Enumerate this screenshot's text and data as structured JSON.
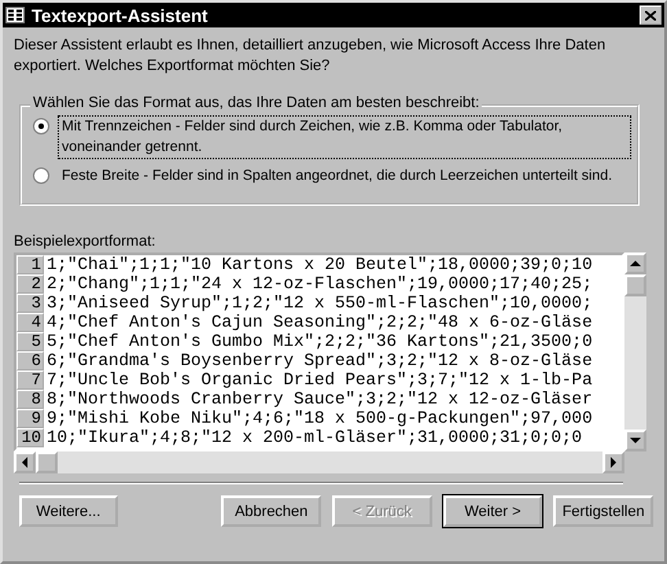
{
  "window": {
    "title": "Textexport-Assistent"
  },
  "intro": "Dieser Assistent erlaubt es Ihnen, detailliert anzugeben, wie Microsoft Access Ihre Daten exportiert.  Welches Exportformat möchten Sie?",
  "format_group": {
    "legend": "Wählen Sie das Format aus, das Ihre Daten am besten beschreibt:",
    "options": [
      {
        "label": "Mit Trennzeichen - Felder sind durch Zeichen, wie z.B. Komma oder Tabulator, voneinander getrennt.",
        "selected": true
      },
      {
        "label": "Feste Breite - Felder sind in Spalten angeordnet, die durch Leerzeichen unterteilt sind.",
        "selected": false
      }
    ]
  },
  "preview": {
    "label": "Beispielexportformat:",
    "rows": [
      {
        "number": "1",
        "text": "1;\"Chai\";1;1;\"10 Kartons x 20 Beutel\";18,0000;39;0;10"
      },
      {
        "number": "2",
        "text": "2;\"Chang\";1;1;\"24 x 12-oz-Flaschen\";19,0000;17;40;25;"
      },
      {
        "number": "3",
        "text": "3;\"Aniseed Syrup\";1;2;\"12 x 550-ml-Flaschen\";10,0000;"
      },
      {
        "number": "4",
        "text": "4;\"Chef Anton's Cajun Seasoning\";2;2;\"48 x 6-oz-Gläse"
      },
      {
        "number": "5",
        "text": "5;\"Chef Anton's Gumbo Mix\";2;2;\"36 Kartons\";21,3500;0"
      },
      {
        "number": "6",
        "text": "6;\"Grandma's Boysenberry Spread\";3;2;\"12 x 8-oz-Gläse"
      },
      {
        "number": "7",
        "text": "7;\"Uncle Bob's Organic Dried Pears\";3;7;\"12 x 1-lb-Pa"
      },
      {
        "number": "8",
        "text": "8;\"Northwoods Cranberry Sauce\";3;2;\"12 x 12-oz-Gläser"
      },
      {
        "number": "9",
        "text": "9;\"Mishi Kobe Niku\";4;6;\"18 x 500-g-Packungen\";97,000"
      },
      {
        "number": "10",
        "text": "10;\"Ikura\";4;8;\"12 x 200-ml-Gläser\";31,0000;31;0;0;0"
      }
    ]
  },
  "buttons": [
    {
      "label": "Weitere...",
      "disabled": false,
      "default": false
    },
    {
      "label": "Abbrechen",
      "disabled": false,
      "default": false
    },
    {
      "label": "< Zurück",
      "disabled": true,
      "default": false
    },
    {
      "label": "Weiter >",
      "disabled": false,
      "default": true
    },
    {
      "label": "Fertigstellen",
      "disabled": false,
      "default": false
    }
  ]
}
